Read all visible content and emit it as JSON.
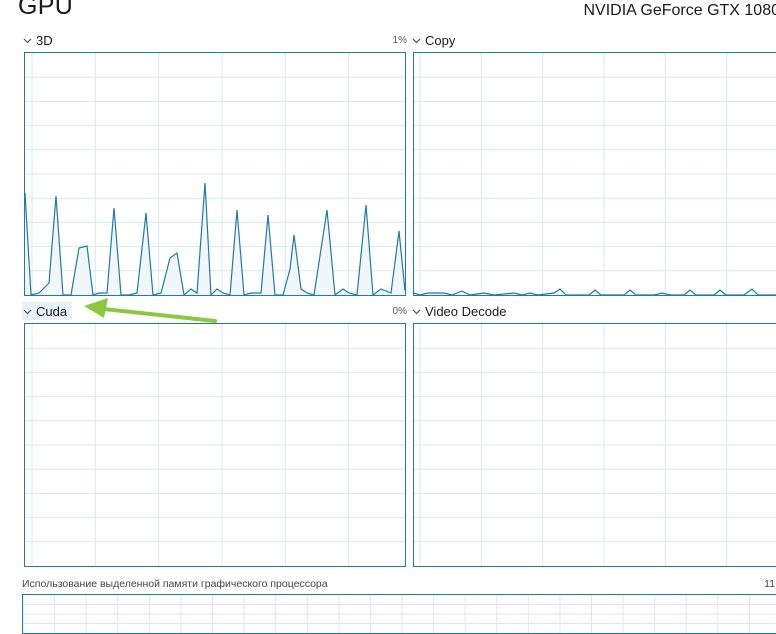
{
  "header": {
    "title": "GPU",
    "device_name": "NVIDIA GeForce GTX 1080"
  },
  "engines": [
    {
      "name": "3D",
      "percent": "1%"
    },
    {
      "name": "Copy",
      "percent": ""
    },
    {
      "name": "Cuda",
      "percent": "0%"
    },
    {
      "name": "Video Decode",
      "percent": ""
    }
  ],
  "memory": {
    "label": "Использование выделенной памяти графического процессора",
    "value": "11,"
  },
  "colors": {
    "graph_line": "#1f7aa8",
    "graph_fill": "#f1f6fa",
    "grid": "#d7e8f2",
    "annotation_arrow": "#8dc63f"
  },
  "icons": {
    "collapse": "chevron-down-icon"
  }
}
